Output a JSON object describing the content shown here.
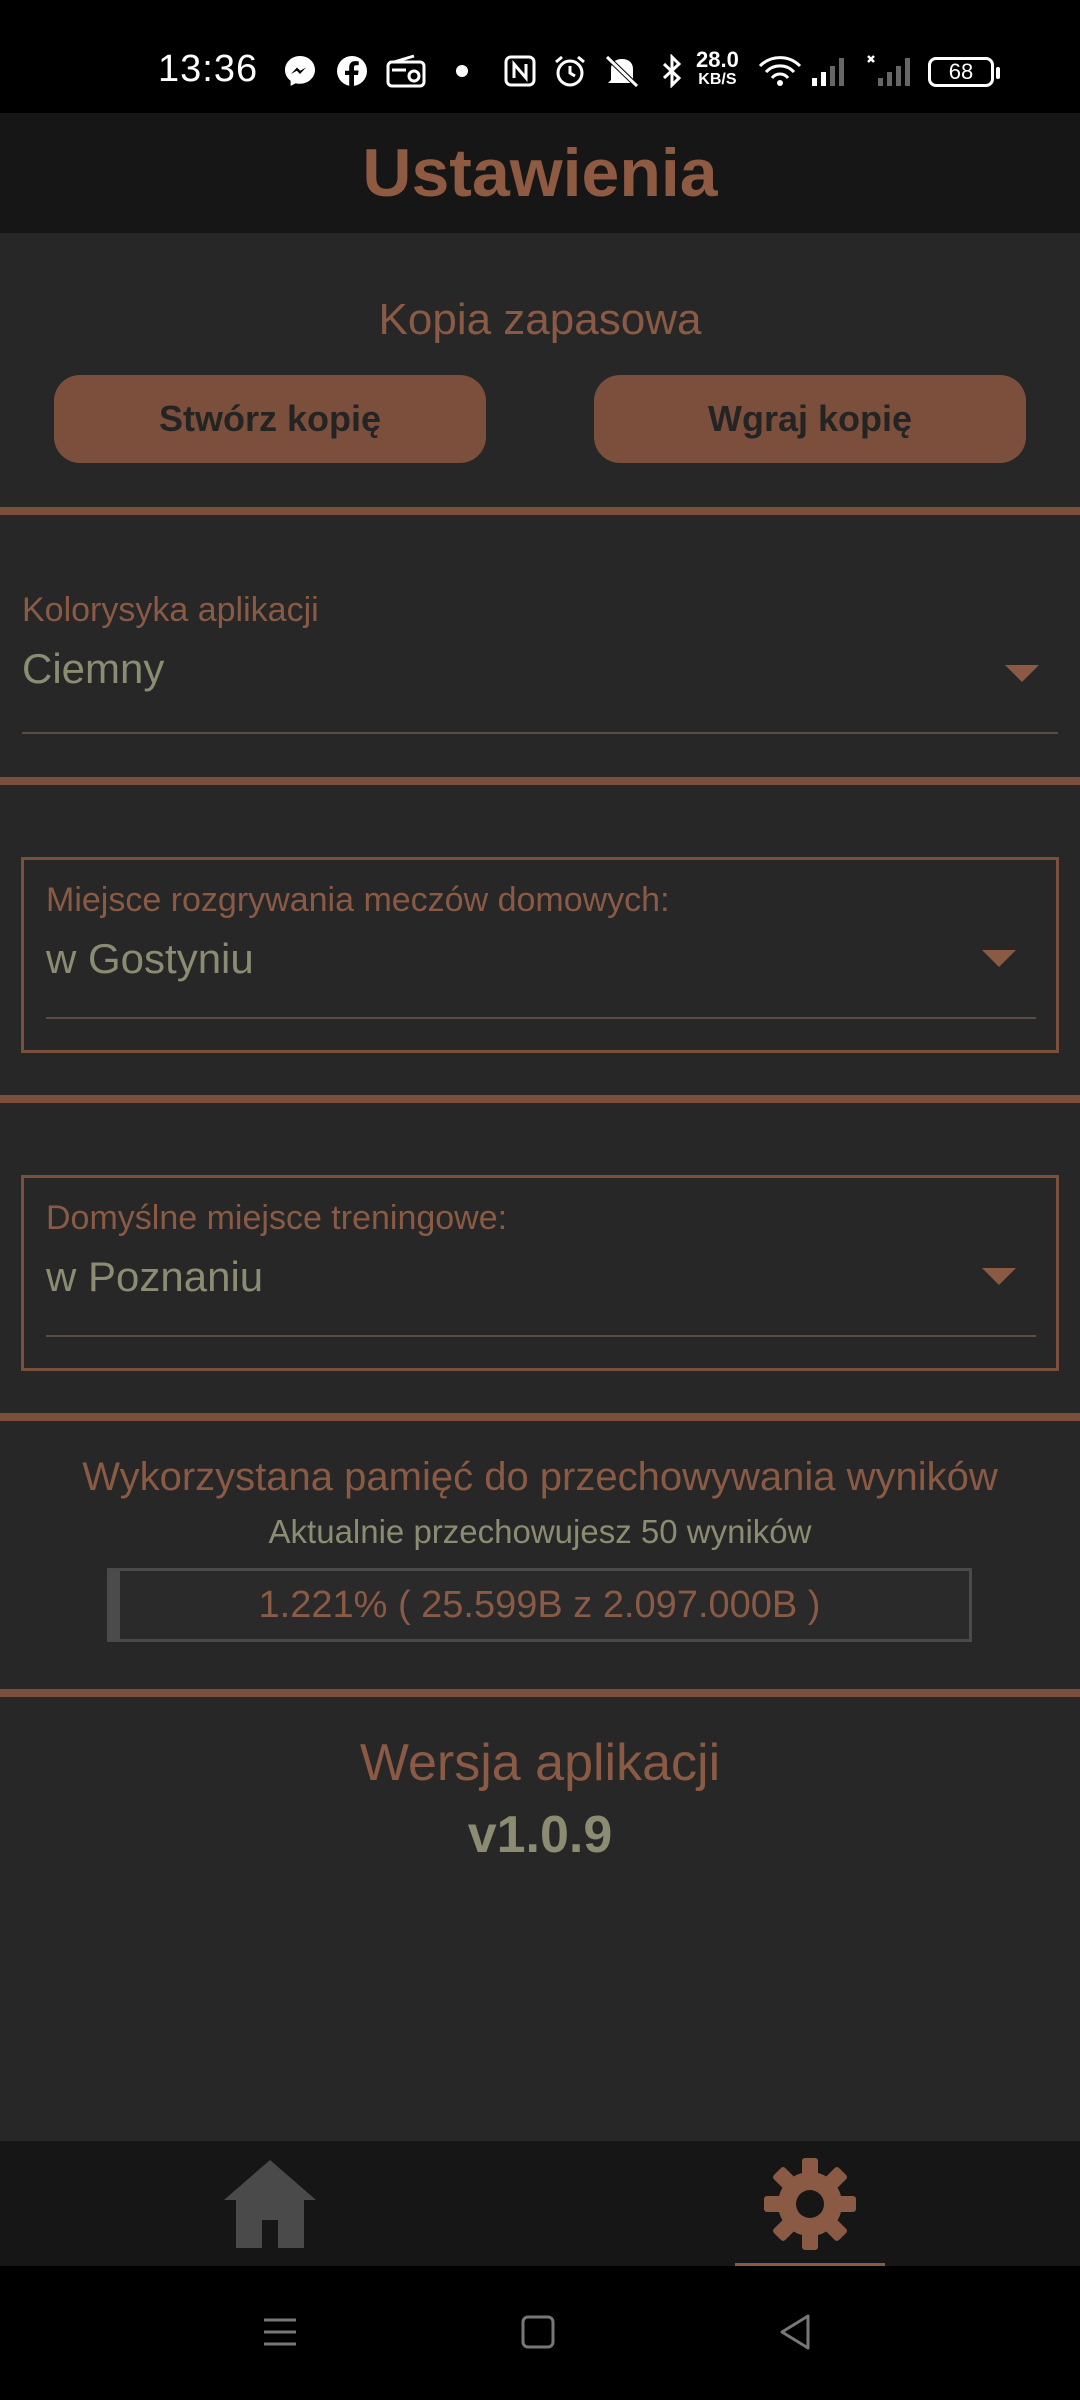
{
  "status_bar": {
    "time": "13:36",
    "net_speed": "28.0",
    "net_unit": "KB/S",
    "battery": "68",
    "icons": [
      "messenger-icon",
      "facebook-icon",
      "radio-icon",
      "dot-icon",
      "nfc-icon",
      "alarm-icon",
      "mute-icon",
      "bluetooth-icon",
      "wifi-icon",
      "signal-icon",
      "signal-2-icon"
    ]
  },
  "header": {
    "title": "Ustawienia"
  },
  "backup": {
    "title": "Kopia zapasowa",
    "create_label": "Stwórz kopię",
    "restore_label": "Wgraj kopię"
  },
  "theme": {
    "label": "Kolorysyka aplikacji",
    "value": "Ciemny"
  },
  "home_venue": {
    "label": "Miejsce rozgrywania meczów domowych:",
    "value": "w Gostyniu"
  },
  "training_venue": {
    "label": "Domyślne miejsce treningowe:",
    "value": "w Poznaniu"
  },
  "storage": {
    "title": "Wykorzystana pamięć do przechowywania wyników",
    "subtitle": "Aktualnie przechowujesz 50 wyników",
    "usage_text": "1.221% ( 25.599B  z  2.097.000B )",
    "usage_fraction": 0.01221
  },
  "version": {
    "title": "Wersja aplikacji",
    "value": "v1.0.9"
  },
  "bottom_nav": {
    "items": [
      {
        "icon": "home-icon",
        "active": false
      },
      {
        "icon": "gear-icon",
        "active": true
      }
    ]
  },
  "system_nav": [
    "menu-icon",
    "home-square-icon",
    "back-icon"
  ],
  "colors": {
    "accent": "#8a5a45",
    "button": "#7b4f3b",
    "background": "#272727",
    "header": "#161616",
    "value_text": "#8b8c72"
  }
}
